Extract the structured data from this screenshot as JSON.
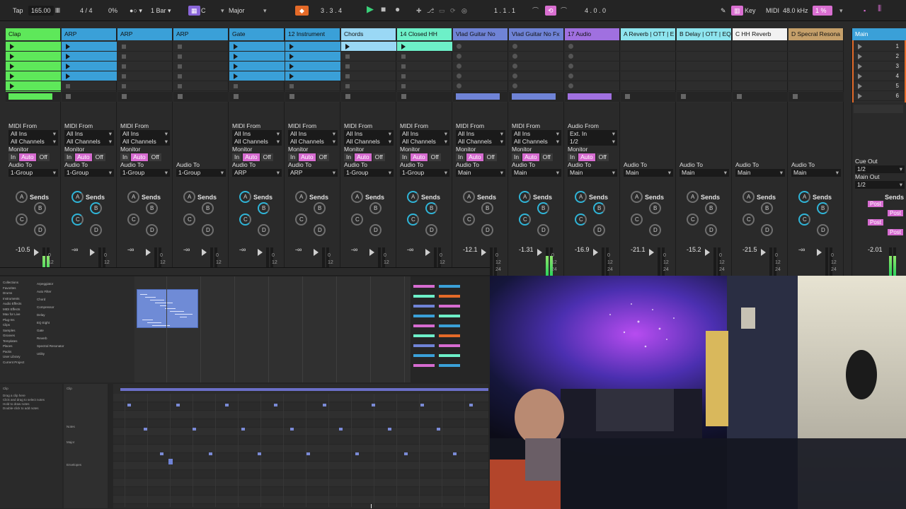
{
  "transport": {
    "tap": "Tap",
    "tempo": "165.00",
    "meter_icon": "metronome-bars-icon",
    "signature": "4 / 4",
    "swing": "0%",
    "follow": "●○ ▾",
    "quantize": "1 Bar ▾",
    "key_root": "C",
    "scale": "Major",
    "scale_options_selected": "Major",
    "position": "3 .  3 .  4",
    "loop_start": "1 .  1 .  1",
    "loop_length": "4 .  0 .  0",
    "key_label": "Key",
    "midi_label": "MIDI",
    "sample_rate": "48.0 kHz",
    "cpu": "1 %"
  },
  "tracks": [
    {
      "name": "Clap",
      "color": "#5ee85a",
      "clip_color": "#5ee85a",
      "midi_from": "MIDI From",
      "input": "All Ins",
      "channel": "All Channels",
      "monitor": "Monitor",
      "in": "In",
      "auto": "Auto",
      "off": "Off",
      "audio_to": "Audio To",
      "dest": "1-Group",
      "volume": "-10.5",
      "send_a": "A",
      "send_b": "B",
      "send_c": "C",
      "send_d": "D"
    },
    {
      "name": "ARP",
      "color": "#3aa0d8",
      "clip_color": "#3aa0d8",
      "midi_from": "MIDI From",
      "input": "All Ins",
      "channel": "All Channels",
      "monitor": "Monitor",
      "in": "In",
      "auto": "Auto",
      "off": "Off",
      "audio_to": "Audio To",
      "dest": "1-Group",
      "volume": "-∞",
      "send_a": "A",
      "send_b": "B",
      "send_c": "C",
      "send_d": "D"
    },
    {
      "name": "ARP",
      "color": "#3aa0d8",
      "clip_color": "#3aa0d8",
      "midi_from": "MIDI From",
      "input": "All Ins",
      "channel": "All Channels",
      "monitor": "Monitor",
      "in": "In",
      "auto": "Auto",
      "off": "Off",
      "audio_to": "Audio To",
      "dest": "1-Group",
      "volume": "-∞",
      "send_a": "A",
      "send_b": "B",
      "send_c": "C",
      "send_d": "D"
    },
    {
      "name": "ARP",
      "color": "#3aa0d8",
      "clip_color": "#3aa0d8",
      "midi_from": "",
      "input": "",
      "channel": "",
      "monitor": "",
      "in": "",
      "auto": "",
      "off": "",
      "audio_to": "Audio To",
      "dest": "1-Group",
      "volume": "-∞",
      "send_a": "A",
      "send_b": "B",
      "send_c": "C",
      "send_d": "D"
    },
    {
      "name": "Gate",
      "color": "#3aa0d8",
      "clip_color": "#3aa0d8",
      "midi_from": "MIDI From",
      "input": "All Ins",
      "channel": "All Channels",
      "monitor": "Monitor",
      "in": "In",
      "auto": "Auto",
      "off": "Off",
      "audio_to": "Audio To",
      "dest": "ARP",
      "volume": "-∞",
      "send_a": "A",
      "send_b": "B",
      "send_c": "C",
      "send_d": "D"
    },
    {
      "name": "12 Instrument",
      "color": "#3aa0d8",
      "clip_color": "#3aa0d8",
      "midi_from": "MIDI From",
      "input": "All Ins",
      "channel": "All Channels",
      "monitor": "Monitor",
      "in": "In",
      "auto": "Auto",
      "off": "Off",
      "audio_to": "Audio To",
      "dest": "ARP",
      "volume": "-∞",
      "send_a": "A",
      "send_b": "B",
      "send_c": "C",
      "send_d": "D"
    },
    {
      "name": "Chords",
      "color": "#9ad8f5",
      "clip_color": "#9ad8f5",
      "midi_from": "MIDI From",
      "input": "All Ins",
      "channel": "All Channels",
      "monitor": "Monitor",
      "in": "In",
      "auto": "Auto",
      "off": "Off",
      "audio_to": "Audio To",
      "dest": "1-Group",
      "volume": "-∞",
      "send_a": "A",
      "send_b": "B",
      "send_c": "C",
      "send_d": "D"
    },
    {
      "name": "14 Closed HH",
      "color": "#6df0c8",
      "clip_color": "#6df0c8",
      "midi_from": "MIDI From",
      "input": "All Ins",
      "channel": "All Channels",
      "monitor": "Monitor",
      "in": "In",
      "auto": "Auto",
      "off": "Off",
      "audio_to": "Audio To",
      "dest": "1-Group",
      "volume": "-∞",
      "send_a": "A",
      "send_b": "B",
      "send_c": "C",
      "send_d": "D"
    },
    {
      "name": "Vlad Guitar No",
      "color": "#6f83d6",
      "clip_color": "#6f83d6",
      "midi_from": "MIDI From",
      "input": "All Ins",
      "channel": "All Channels",
      "monitor": "Monitor",
      "in": "In",
      "auto": "Auto",
      "off": "Off",
      "audio_to": "Audio To",
      "dest": "Main",
      "volume": "-12.1",
      "send_a": "A",
      "send_b": "B",
      "send_c": "C",
      "send_d": "D"
    },
    {
      "name": "Vlad Guitar No Fx",
      "color": "#6f83d6",
      "clip_color": "#6f83d6",
      "midi_from": "MIDI From",
      "input": "All Ins",
      "channel": "All Channels",
      "monitor": "Monitor",
      "in": "In",
      "auto": "Auto",
      "off": "Off",
      "audio_to": "Audio To",
      "dest": "Main",
      "volume": "-1.31",
      "send_a": "A",
      "send_b": "B",
      "send_c": "C",
      "send_d": "D"
    },
    {
      "name": "17 Audio",
      "color": "#a070e0",
      "clip_color": "#a070e0",
      "midi_from": "Audio From",
      "input": "Ext. In",
      "channel": "1/2",
      "monitor": "Monitor",
      "in": "In",
      "auto": "Auto",
      "off": "Off",
      "audio_to": "Audio To",
      "dest": "Main",
      "volume": "-16.9",
      "send_a": "A",
      "send_b": "B",
      "send_c": "C",
      "send_d": "D"
    },
    {
      "name": "A Reverb | OTT | E",
      "color": "#8ee5ef",
      "clip_color": "#8ee5ef",
      "midi_from": "",
      "input": "",
      "channel": "",
      "monitor": "",
      "in": "",
      "auto": "",
      "off": "",
      "audio_to": "Audio To",
      "dest": "Main",
      "volume": "-21.1",
      "send_a": "A",
      "send_b": "B",
      "send_c": "C",
      "send_d": "D"
    },
    {
      "name": "B Delay | OTT | EQ",
      "color": "#8ee5ef",
      "clip_color": "#8ee5ef",
      "midi_from": "",
      "input": "",
      "channel": "",
      "monitor": "",
      "in": "",
      "auto": "",
      "off": "",
      "audio_to": "Audio To",
      "dest": "Main",
      "volume": "-15.2",
      "send_a": "A",
      "send_b": "B",
      "send_c": "C",
      "send_d": "D"
    },
    {
      "name": "C HH Reverb",
      "color": "#f2f2f2",
      "clip_color": "#f2f2f2",
      "midi_from": "",
      "input": "",
      "channel": "",
      "monitor": "",
      "in": "",
      "auto": "",
      "off": "",
      "audio_to": "Audio To",
      "dest": "Main",
      "volume": "-21.5",
      "send_a": "A",
      "send_b": "B",
      "send_c": "C",
      "send_d": "D"
    },
    {
      "name": "D Specral Resona",
      "color": "#c5a06a",
      "clip_color": "#c5a06a",
      "midi_from": "",
      "input": "",
      "channel": "",
      "monitor": "",
      "in": "",
      "auto": "",
      "off": "",
      "audio_to": "Audio To",
      "dest": "Main",
      "volume": "-∞",
      "send_a": "A",
      "send_b": "B",
      "send_c": "C",
      "send_d": "D"
    }
  ],
  "master": {
    "name": "Main",
    "color": "#3aa0d8",
    "scenes": [
      "1",
      "2",
      "3",
      "4",
      "5",
      "6"
    ],
    "cue_out": "Cue Out",
    "cue_val": "1/2",
    "main_out": "Main Out",
    "main_val": "1/2",
    "sends": "Sends",
    "post": "Post",
    "volume": "-2.01"
  },
  "scale_ticks": [
    "0",
    "12",
    "24"
  ],
  "browser": {
    "items": [
      "Collections",
      "Favorites",
      "Drums",
      "Instruments",
      "Audio Effects",
      "MIDI Effects",
      "Max for Live",
      "Plug-Ins",
      "Clips",
      "Samples",
      "Grooves",
      "Templates",
      "Places",
      "Packs",
      "User Library",
      "Current Project",
      "Arpeggiator",
      "Auto Filter",
      "Chord",
      "Compressor",
      "Delay",
      "EQ Eight",
      "Gate",
      "Reverb",
      "Spectral Resonator",
      "Utility"
    ]
  },
  "clip_view": {
    "title": "Clip",
    "lines": [
      "Drag a clip here",
      "Click and drag to select notes",
      "Hold to draw notes",
      "Double-click to add notes"
    ],
    "scale": "Major",
    "sections": [
      "Clip",
      "Notes",
      "Envelopes"
    ]
  }
}
